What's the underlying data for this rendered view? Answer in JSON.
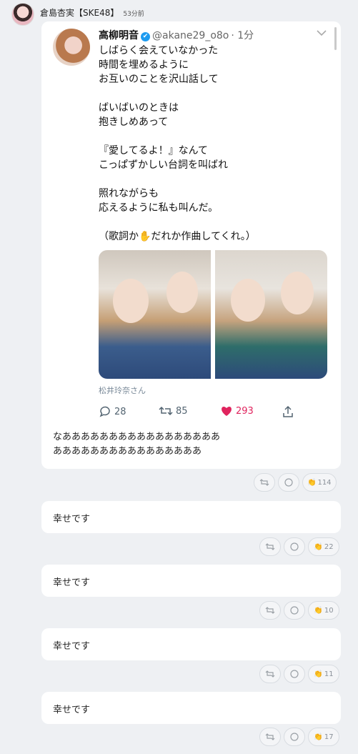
{
  "header": {
    "author": "倉島杏実【SKE48】",
    "time": "53分前"
  },
  "tweet": {
    "name": "高柳明音",
    "verified_mark": "✔",
    "handle": "@akane29_o8o",
    "age": "· 1分",
    "body": "しばらく会えていなかった\n時間を埋めるように\nお互いのことを沢山話して\n\nばいばいのときは\n抱きしめあって\n\n『愛してるよ！』なんて\nこっぱずかしい台詞を叫ばれ\n\n照れながらも\n応えるように私も叫んだ。\n\n（歌詞か✋だれか作曲してくれ。）",
    "photo_credit": "松井玲奈さん",
    "replies": "28",
    "retweets": "85",
    "likes": "293",
    "icons": [
      "reply-icon",
      "retweet-icon",
      "heart-icon",
      "share-icon",
      "chevron-down-icon"
    ]
  },
  "post_comment": "なあああああああああああああああああ\nああああああああああああああああ",
  "reaction_counts": [
    "114",
    "22",
    "10",
    "11",
    "17"
  ],
  "replies": [
    {
      "text": "幸せです"
    },
    {
      "text": "幸せです"
    },
    {
      "text": "幸せです"
    },
    {
      "text": "幸せです"
    }
  ],
  "colors": {
    "background": "#eef0f3",
    "like": "#e0245e",
    "verified": "#1d9bf0"
  }
}
